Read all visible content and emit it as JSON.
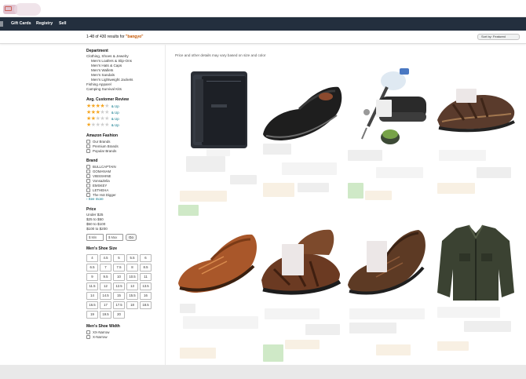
{
  "navbar": {
    "items": [
      "Gift Cards",
      "Registry",
      "Sell"
    ]
  },
  "results": {
    "prefix": "1-48 of 430 results for ",
    "query": "\"bangyo\""
  },
  "sort": {
    "label": "Sort by: Featured"
  },
  "main": {
    "note": "Price and other details may vary based on size and color"
  },
  "sidebar": {
    "department": {
      "title": "Department",
      "items": [
        {
          "label": "Clothing, Shoes & Jewelry",
          "indent": false
        },
        {
          "label": "Men's Loafers & Slip-Ons",
          "indent": true
        },
        {
          "label": "Men's Hats & Caps",
          "indent": true
        },
        {
          "label": "Men's Wallets",
          "indent": true
        },
        {
          "label": "Men's Sandals",
          "indent": true
        },
        {
          "label": "Men's Lightweight Jackets",
          "indent": true
        },
        {
          "label": "Fishing Apparel",
          "indent": false
        },
        {
          "label": "Camping Survival Kits",
          "indent": false
        }
      ]
    },
    "review": {
      "title": "Avg. Customer Review",
      "rows": [
        {
          "rating": 4,
          "label": "& Up"
        },
        {
          "rating": 3,
          "label": "& Up"
        },
        {
          "rating": 2,
          "label": "& Up"
        },
        {
          "rating": 1,
          "label": "& Up"
        }
      ]
    },
    "fashion": {
      "title": "Amazon Fashion",
      "items": [
        "Our Brands",
        "Premium Brands",
        "Popular Brands"
      ]
    },
    "brand": {
      "title": "Brand",
      "items": [
        "BULLCAPTAIN",
        "GOMANAM",
        "VIBSSHINE",
        "VonsaZelia",
        "EMSKEY",
        "LETHEHA",
        "The Hot Digger"
      ],
      "see_more": "› See more"
    },
    "price": {
      "title": "Price",
      "items": [
        "Under $25",
        "$25 to $50",
        "$50 to $100",
        "$100 to $200"
      ],
      "min_placeholder": "$ Min",
      "max_placeholder": "$ Max",
      "go": "Go"
    },
    "shoe_size": {
      "title": "Men's Shoe Size",
      "sizes": [
        "4",
        "4.5",
        "5",
        "5.5",
        "6",
        "6.5",
        "7",
        "7.5",
        "8",
        "8.5",
        "9",
        "9.5",
        "10",
        "10.5",
        "11",
        "11.5",
        "12",
        "12.5",
        "13",
        "13.5",
        "14",
        "14.5",
        "15",
        "15.5",
        "16",
        "16.5",
        "17",
        "17.5",
        "18",
        "18.5",
        "19",
        "19.5",
        "20"
      ]
    },
    "shoe_width": {
      "title": "Men's Shoe Width",
      "items": [
        "XX-Narrow",
        "X-Narrow"
      ]
    }
  },
  "products": [
    {
      "icon": "wallet-icon"
    },
    {
      "icon": "loafer-shoe-icon"
    },
    {
      "icon": "grinder-tool-icon"
    },
    {
      "icon": "leather-sandal-icon"
    },
    {
      "icon": "leather-shoe-icon"
    },
    {
      "icon": "brown-sandal-icon"
    },
    {
      "icon": "brown-boot-shoe-icon"
    },
    {
      "icon": "jacket-icon"
    }
  ],
  "colors": {
    "nav_bg": "#232f3e",
    "query": "#c45500",
    "star": "#f5a623",
    "link": "#007185"
  }
}
